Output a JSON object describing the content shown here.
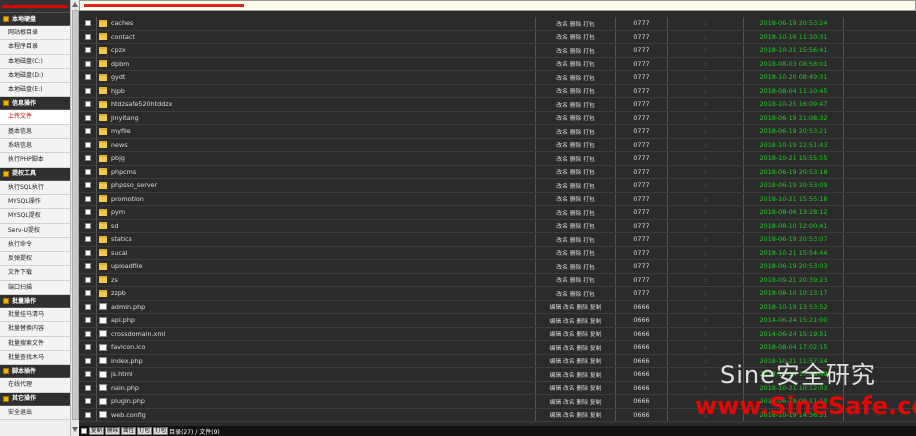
{
  "sidebar": {
    "sections": [
      {
        "title": "本地硬盘",
        "items": [
          "网站根目录",
          "本程序目录",
          "本地磁盘(C:)",
          "本地磁盘(D:)",
          "本地磁盘(E:)"
        ]
      },
      {
        "title": "信息操作",
        "items": [
          "上传文件",
          "基本信息",
          "系统信息",
          "执行PHP脚本"
        ]
      },
      {
        "title": "提权工具",
        "items": [
          "执行SQL执行",
          "MYSQL操作",
          "MYSQL提权",
          "Serv-U提权",
          "执行命令",
          "反弹提权",
          "文件下载",
          "端口扫描"
        ]
      },
      {
        "title": "批量操作",
        "items": [
          "批量挂马清马",
          "批量替换内容",
          "批量搜索文件",
          "批量查找木马"
        ]
      },
      {
        "title": "脚本插件",
        "items": [
          "在线代理"
        ]
      },
      {
        "title": "其它操作",
        "items": [
          "安全退出"
        ]
      }
    ],
    "active_item": "上传文件"
  },
  "rows": [
    {
      "type": "folder",
      "name": "caches",
      "actions": "改名 删除 打包",
      "perm": "0777",
      "owner": ":",
      "date": "2018-06-19 20:53:24"
    },
    {
      "type": "folder",
      "name": "contact",
      "actions": "改名 删除 打包",
      "perm": "0777",
      "owner": ":",
      "date": "2018-10-16 11:10:31"
    },
    {
      "type": "folder",
      "name": "cpzx",
      "actions": "改名 删除 打包",
      "perm": "0777",
      "owner": ":",
      "date": "2018-10-21 15:56:41"
    },
    {
      "type": "folder",
      "name": "dpbm",
      "actions": "改名 删除 打包",
      "perm": "0777",
      "owner": ":",
      "date": "2018-08-03 08:58:01"
    },
    {
      "type": "folder",
      "name": "gydt",
      "actions": "改名 删除 打包",
      "perm": "0777",
      "owner": ":",
      "date": "2018-10-20 08:49:31"
    },
    {
      "type": "folder",
      "name": "hjpb",
      "actions": "改名 删除 打包",
      "perm": "0777",
      "owner": ":",
      "date": "2018-08-04 11:10:45"
    },
    {
      "type": "folder",
      "name": "htdzsafe520htddzx",
      "actions": "改名 删除 打包",
      "perm": "0777",
      "owner": ":",
      "date": "2018-10-25 16:09:47"
    },
    {
      "type": "folder",
      "name": "jinyitang",
      "actions": "改名 删除 打包",
      "perm": "0777",
      "owner": ":",
      "date": "2018-06-19 21:08:32"
    },
    {
      "type": "folder",
      "name": "myfile",
      "actions": "改名 删除 打包",
      "perm": "0777",
      "owner": ":",
      "date": "2018-06-19 20:53:21"
    },
    {
      "type": "folder",
      "name": "news",
      "actions": "改名 删除 打包",
      "perm": "0777",
      "owner": ":",
      "date": "2018-10-19 22:51:43"
    },
    {
      "type": "folder",
      "name": "pbjg",
      "actions": "改名 删除 打包",
      "perm": "0777",
      "owner": ":",
      "date": "2018-10-21 15:55:55"
    },
    {
      "type": "folder",
      "name": "phpcms",
      "actions": "改名 删除 打包",
      "perm": "0777",
      "owner": ":",
      "date": "2018-06-19 20:53:18"
    },
    {
      "type": "folder",
      "name": "phpsso_server",
      "actions": "改名 删除 打包",
      "perm": "0777",
      "owner": ":",
      "date": "2018-06-19 20:53:09"
    },
    {
      "type": "folder",
      "name": "promotion",
      "actions": "改名 删除 打包",
      "perm": "0777",
      "owner": ":",
      "date": "2018-10-21 15:55:18"
    },
    {
      "type": "folder",
      "name": "pym",
      "actions": "改名 删除 打包",
      "perm": "0777",
      "owner": ":",
      "date": "2018-08-06 13:28:12"
    },
    {
      "type": "folder",
      "name": "sd",
      "actions": "改名 删除 打包",
      "perm": "0777",
      "owner": ":",
      "date": "2018-08-10 12:00:41"
    },
    {
      "type": "folder",
      "name": "statics",
      "actions": "改名 删除 打包",
      "perm": "0777",
      "owner": ":",
      "date": "2018-06-19 20:53:07"
    },
    {
      "type": "folder",
      "name": "sucai",
      "actions": "改名 删除 打包",
      "perm": "0777",
      "owner": ":",
      "date": "2018-10-21 15:54:44"
    },
    {
      "type": "folder",
      "name": "uploadfile",
      "actions": "改名 删除 打包",
      "perm": "0777",
      "owner": ":",
      "date": "2018-06-19 20:53:03"
    },
    {
      "type": "folder",
      "name": "zs",
      "actions": "改名 删除 打包",
      "perm": "0777",
      "owner": ":",
      "date": "2018-09-21 20:39:23"
    },
    {
      "type": "folder",
      "name": "zzpb",
      "actions": "改名 删除 打包",
      "perm": "0777",
      "owner": ":",
      "date": "2018-08-10 10:13:17"
    },
    {
      "type": "file",
      "name": "admin.php",
      "actions": "编辑 改名 删除 复制",
      "perm": "0666",
      "owner": ":",
      "date": "2018-10-19 13:53:52"
    },
    {
      "type": "file",
      "name": "api.php",
      "actions": "编辑 改名 删除 复制",
      "perm": "0666",
      "owner": ":",
      "date": "2014-06-24 15:21:00"
    },
    {
      "type": "file",
      "name": "crossdomain.xml",
      "actions": "编辑 改名 删除 复制",
      "perm": "0666",
      "owner": ":",
      "date": "2014-06-24 15:19:51"
    },
    {
      "type": "file",
      "name": "favicon.ico",
      "actions": "编辑 改名 删除 复制",
      "perm": "0666",
      "owner": ":",
      "date": "2018-08-04 17:02:15"
    },
    {
      "type": "file",
      "name": "index.php",
      "actions": "编辑 改名 删除 复制",
      "perm": "0666",
      "owner": ":",
      "date": "2018-10-21 11:57:34"
    },
    {
      "type": "file",
      "name": "js.html",
      "actions": "编辑 改名 删除 复制",
      "perm": "0666",
      "owner": ":",
      "date": "2018-10-14 17:48:49"
    },
    {
      "type": "file",
      "name": "nain.php",
      "actions": "编辑 改名 删除 复制",
      "perm": "0666",
      "owner": ":",
      "date": "2018-10-21 10:12:03"
    },
    {
      "type": "file",
      "name": "plugin.php",
      "actions": "编辑 改名 删除 复制",
      "perm": "0666",
      "owner": ":",
      "date": "2018-06-19 09:11:10"
    },
    {
      "type": "file",
      "name": "web.config",
      "actions": "编辑 改名 删除 复制",
      "perm": "0666",
      "owner": ":",
      "date": "2018-10-19 14:36:31"
    }
  ],
  "bottom": {
    "buttons": [
      "复制",
      "删除",
      "属性",
      "打包",
      "打包"
    ],
    "summary": "目录(27) / 文件(9)"
  },
  "watermark": {
    "line1": "Sine安全研究",
    "line2": "www.SineSafe.com"
  },
  "colors": {
    "date": "#22cc22",
    "watermark_red": "#ff0000",
    "sidebar_active": "#cc0000",
    "folder": "#f2c94c"
  }
}
